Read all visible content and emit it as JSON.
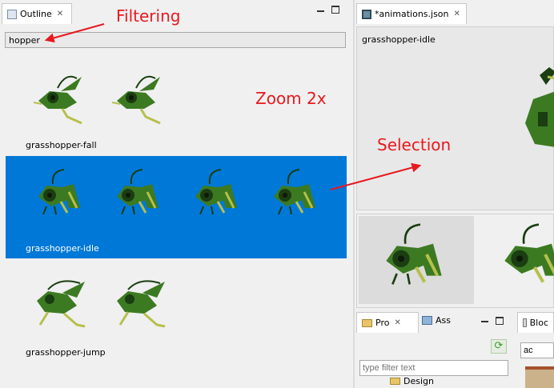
{
  "outline": {
    "tab_label": "Outline",
    "filter_value": "hopper",
    "groups": [
      {
        "label": "grasshopper-fall"
      },
      {
        "label": "grasshopper-idle"
      },
      {
        "label": "grasshopper-jump"
      }
    ]
  },
  "annotations": {
    "filtering": "Filtering",
    "zoom": "Zoom 2x",
    "selection": "Selection"
  },
  "editor": {
    "tab_label": "*animations.json",
    "animation_name": "grasshopper-idle"
  },
  "bottom_left": {
    "tabs": [
      {
        "label": "Pro"
      },
      {
        "label": "Ass"
      }
    ],
    "filter_placeholder": "type filter text",
    "tree_item": "Design"
  },
  "bottom_right": {
    "tab_label": "Bloc",
    "input_value": "ac"
  },
  "colors": {
    "selection": "#0078d7",
    "annotation": "#e8191e",
    "sprite_dark": "#1b3d12",
    "sprite_mid": "#3c7a22",
    "sprite_light": "#b6c04a"
  }
}
